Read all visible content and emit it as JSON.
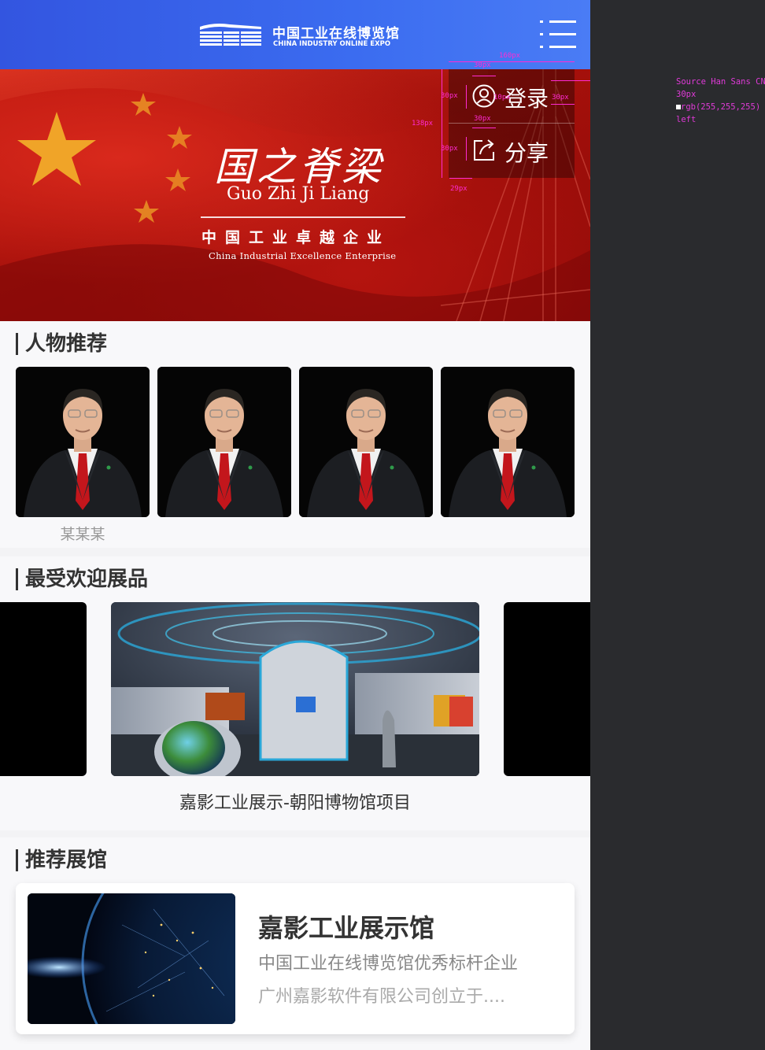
{
  "header": {
    "logo_cn": "中国工业在线博览馆",
    "logo_en": "CHINA INDUSTRY ONLINE EXPO",
    "menu_icon": "hamburger-menu-icon"
  },
  "banner": {
    "title_cn": "国之脊梁",
    "title_pinyin": "Guo Zhi Ji Liang",
    "subtitle_cn": "中国工业卓越企业",
    "subtitle_en": "China Industrial Excellence Enterprise"
  },
  "popup": {
    "login_label": "登录",
    "login_icon": "user-icon",
    "share_label": "分享",
    "share_icon": "share-icon"
  },
  "annotations": {
    "width_160": "160px",
    "width_30a": "30px",
    "height_30a": "30px",
    "gap_10": "10px",
    "right_30": "30px",
    "height_138": "138px",
    "width_30b": "30px",
    "height_30b": "30px",
    "left_29": "29px",
    "font_family": "Source Han Sans CN",
    "font_size": "30px",
    "font_color": "rgb(255,255,255)",
    "text_align": "left"
  },
  "people": {
    "title": "人物推荐",
    "items": [
      {
        "name": "某某某"
      },
      {
        "name": ""
      },
      {
        "name": ""
      },
      {
        "name": ""
      }
    ]
  },
  "exhibits": {
    "title": "最受欢迎展品",
    "current_caption": "嘉影工业展示-朝阳博物馆项目"
  },
  "halls": {
    "title": "推荐展馆",
    "items": [
      {
        "name": "嘉影工业展示馆",
        "tag": "中国工业在线博览馆优秀标杆企业",
        "desc": "广州嘉影软件有限公司创立于...."
      }
    ]
  },
  "colors": {
    "header_blue": "#3b6cf0",
    "banner_red": "#b5140f",
    "annotation_magenta": "#ff2bd4"
  }
}
